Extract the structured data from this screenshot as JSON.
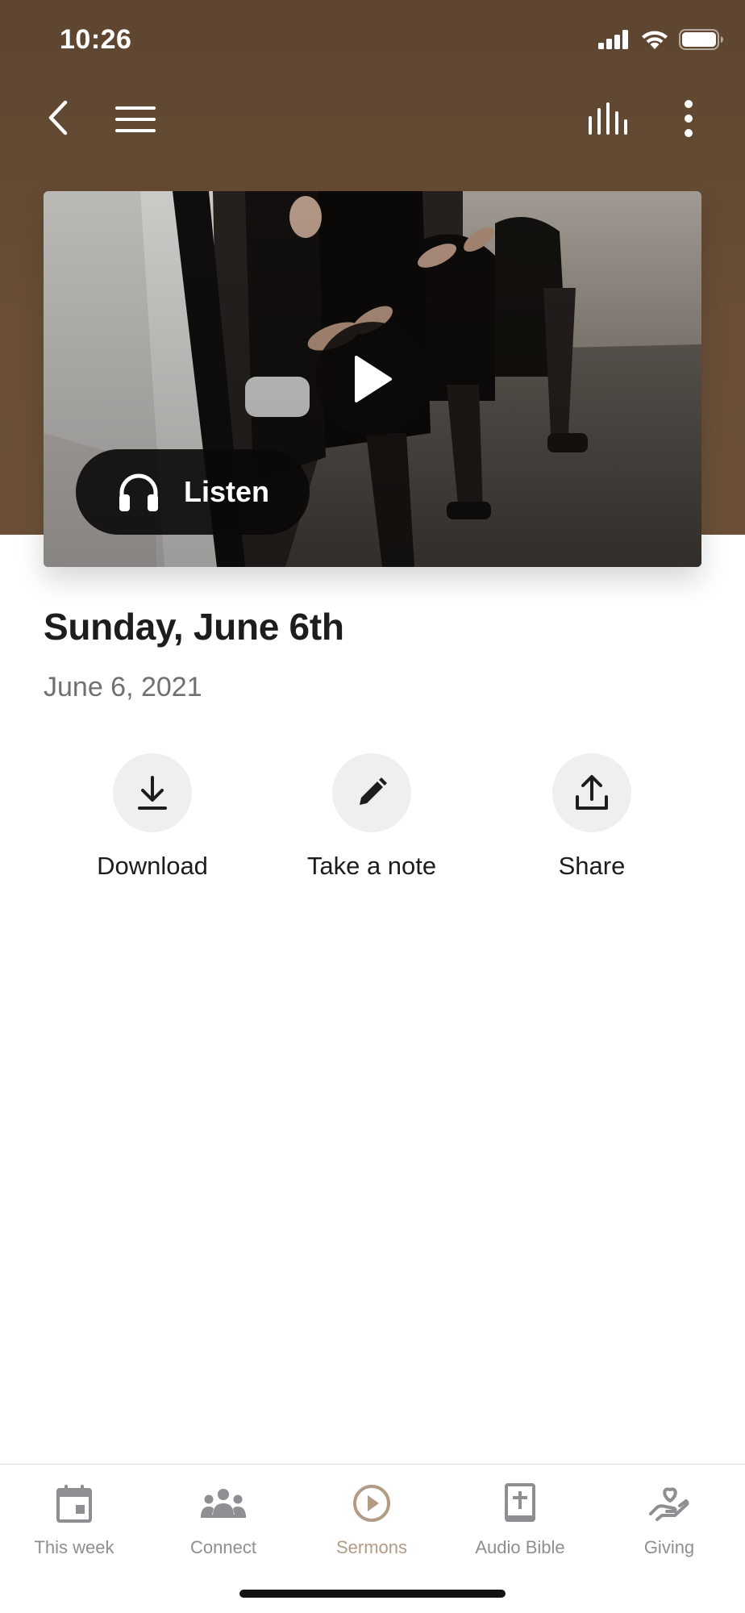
{
  "status_bar": {
    "time": "10:26"
  },
  "nav": {
    "back_icon": "chevron-left-icon",
    "menu_icon": "hamburger-menu-icon",
    "audio_icon": "equalizer-bars-icon",
    "more_icon": "vertical-ellipsis-icon"
  },
  "hero": {
    "play_icon": "play-icon",
    "listen_label": "Listen",
    "listen_icon": "headphones-icon"
  },
  "sermon": {
    "title": "Sunday, June 6th",
    "date": "June 6, 2021"
  },
  "actions": [
    {
      "label": "Download",
      "icon": "download-icon"
    },
    {
      "label": "Take a note",
      "icon": "pencil-icon"
    },
    {
      "label": "Share",
      "icon": "share-upload-icon"
    }
  ],
  "tabs": [
    {
      "label": "This week",
      "icon": "calendar-icon",
      "active": false
    },
    {
      "label": "Connect",
      "icon": "people-group-icon",
      "active": false
    },
    {
      "label": "Sermons",
      "icon": "play-circle-icon",
      "active": true
    },
    {
      "label": "Audio Bible",
      "icon": "bible-icon",
      "active": false
    },
    {
      "label": "Giving",
      "icon": "heart-hand-icon",
      "active": false
    }
  ],
  "colors": {
    "header_brown": "#5d4530",
    "accent_active_tab": "#b39b86",
    "inactive_tab": "#8e8e93",
    "action_circle": "#efefef"
  }
}
